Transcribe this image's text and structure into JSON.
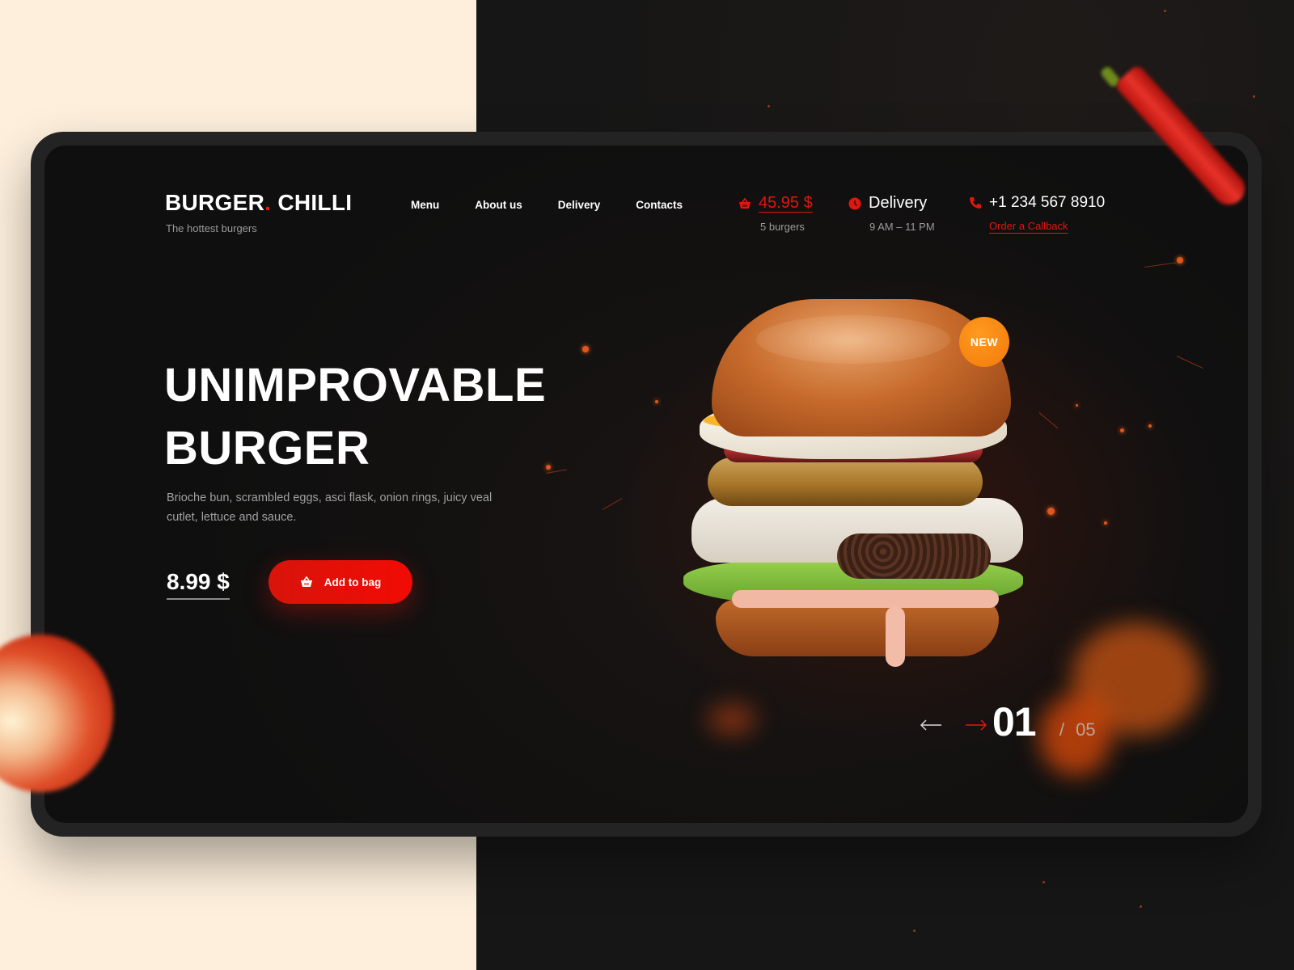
{
  "brand": {
    "name_part1": "BURGER",
    "dot": ".",
    "name_part2": " CHILLI",
    "tagline": "The hottest burgers"
  },
  "nav": {
    "items": [
      {
        "label": "Menu"
      },
      {
        "label": "About us"
      },
      {
        "label": "Delivery"
      },
      {
        "label": "Contacts"
      }
    ]
  },
  "cart": {
    "icon": "basket-icon",
    "total": "45.95 $",
    "count_label": "5 burgers"
  },
  "delivery": {
    "icon": "clock-icon",
    "title": "Delivery",
    "hours": "9 AM – 11 PM"
  },
  "contact": {
    "icon": "phone-icon",
    "phone": "+1 234 567 8910",
    "callback_label": "Order a Callback"
  },
  "hero": {
    "title_line1": "UNIMPROVABLE",
    "title_line2": "BURGER",
    "description": "Brioche bun, scrambled eggs, asci flask, onion rings, juicy veal cutlet, lettuce and sauce.",
    "price": "8.99 $",
    "add_button_label": "Add to bag",
    "badge": "NEW"
  },
  "slider": {
    "current": "01",
    "separator": "/",
    "total": "05",
    "prev_icon": "arrow-left-icon",
    "next_icon": "arrow-right-icon"
  },
  "colors": {
    "accent": "#e0170d",
    "badge": "#f27a0c",
    "left_background": "#fdefdc",
    "right_background": "#161616"
  }
}
